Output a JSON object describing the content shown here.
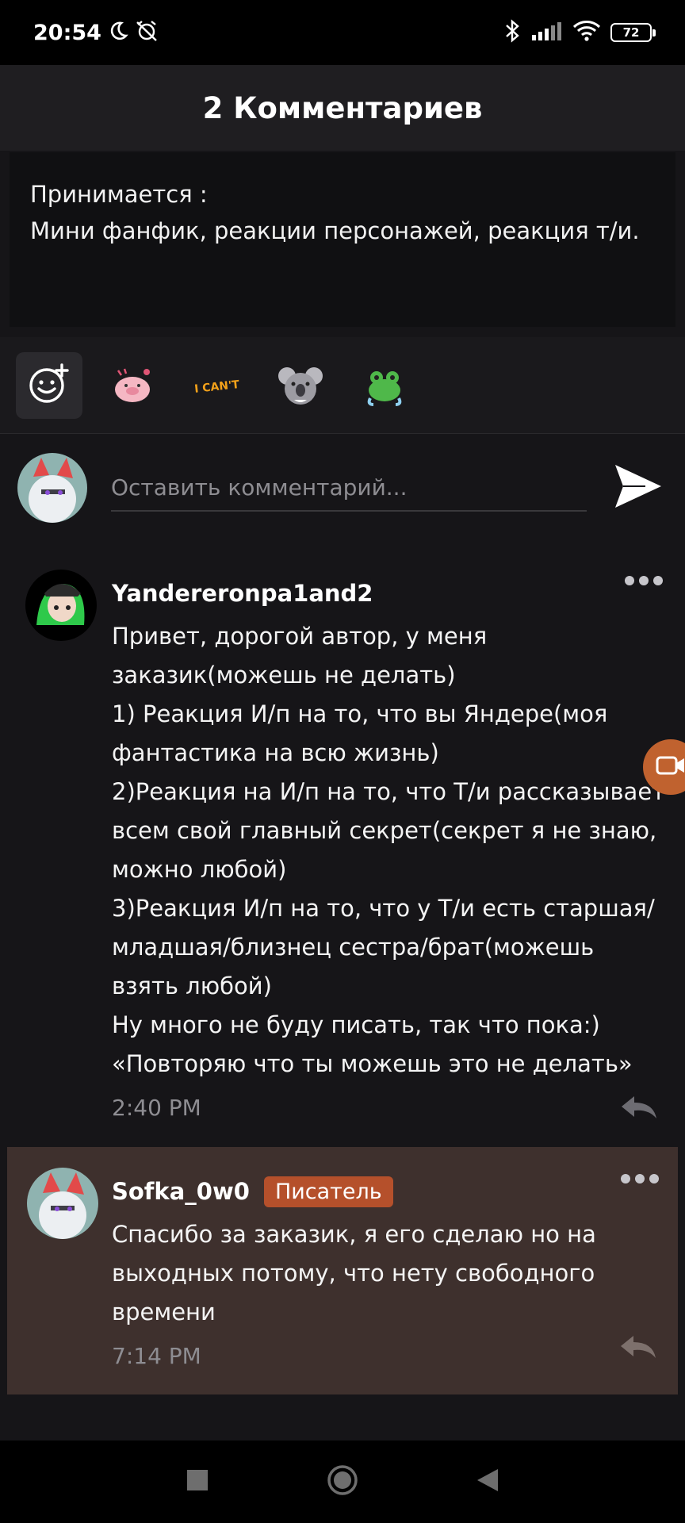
{
  "status_bar": {
    "time": "20:54",
    "battery": "72",
    "icons": [
      "moon-icon",
      "alarm-off-icon",
      "bluetooth-icon",
      "signal-icon",
      "wifi-icon",
      "battery-indicator"
    ]
  },
  "header": {
    "title": "2 Комментариев"
  },
  "description": {
    "line1": "Принимается :",
    "line2": "Мини фанфик, реакции персонажей, реакция т/и."
  },
  "stickers": {
    "items": [
      "add-emoji-icon",
      "sticker-pig",
      "sticker-i-cant",
      "sticker-koala",
      "sticker-frog"
    ]
  },
  "composer": {
    "placeholder": "Оставить комментарий..."
  },
  "comments": [
    {
      "username": "Yandereronpa1and2",
      "text": "Привет, дорогой автор, у меня\nзаказик(можешь не делать)\n1) Реакция И/п на то, что вы Яндере(моя\nфантастика на всю жизнь)\n2)Реакция на И/п на то, что Т/и рассказывает\nвсем свой главный секрет(секрет я не знаю,\nможно любой)\n3)Реакция И/п на то, что у Т/и есть старшая/\nмладшая/близнец сестра/брат(можешь\nвзять любой)\nНу много не буду писать, так что пока:)\n«Повторяю что ты можешь это не делать»",
      "time": "2:40 PM"
    },
    {
      "username": "Sofka_0w0",
      "badge": "Писатель",
      "text": "Спасибо за заказик, я его сделаю но на\nвыходных потому, что нету свободного\nвремени",
      "time": "7:14 PM"
    }
  ],
  "colors": {
    "background": "#161518",
    "header": "#1f1e21",
    "author_reply_bg": "#3e302d",
    "badge": "#b5502b",
    "floating_button": "#c0622f"
  }
}
